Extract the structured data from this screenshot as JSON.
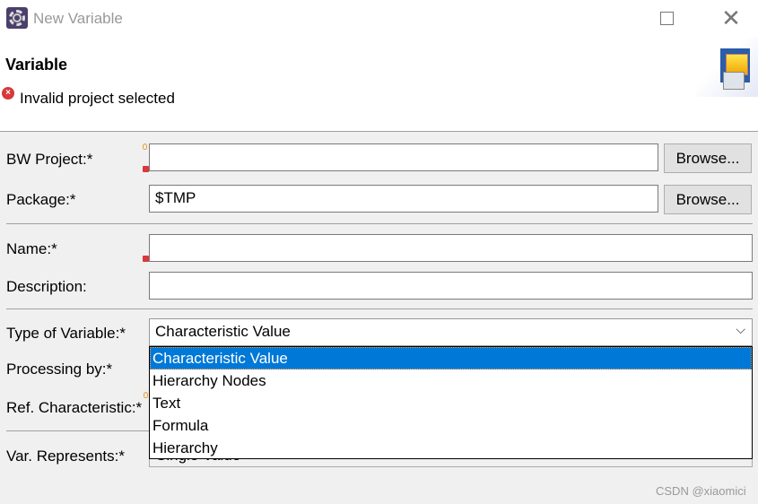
{
  "window": {
    "title": "New Variable"
  },
  "header": {
    "title": "Variable",
    "message": "Invalid project selected"
  },
  "form": {
    "bw_project": {
      "label": "BW Project:*",
      "value": "",
      "browse": "Browse..."
    },
    "package": {
      "label": "Package:*",
      "value": "$TMP",
      "browse": "Browse..."
    },
    "name": {
      "label": "Name:*",
      "value": ""
    },
    "description": {
      "label": "Description:",
      "value": ""
    },
    "type_of_variable": {
      "label": "Type of Variable:*",
      "value": "Characteristic Value",
      "options": [
        "Characteristic Value",
        "Hierarchy Nodes",
        "Text",
        "Formula",
        "Hierarchy"
      ]
    },
    "processing_by": {
      "label": "Processing by:*"
    },
    "ref_characteristic": {
      "label": "Ref. Characteristic:*"
    },
    "var_represents": {
      "label": "Var. Represents:*",
      "value": "Single Value"
    }
  },
  "watermark": "CSDN @xiaomici"
}
